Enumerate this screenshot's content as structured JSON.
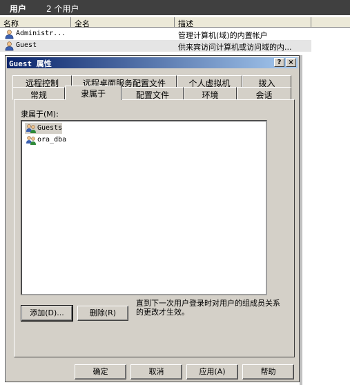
{
  "header": {
    "title": "用户",
    "count": "2 个用户"
  },
  "columns": {
    "name": "名称",
    "fullname": "全名",
    "description": "描述"
  },
  "users": [
    {
      "name": "Administr...",
      "description": "管理计算机(域)的内置帐户"
    },
    {
      "name": "Guest",
      "description": "供来宾访问计算机或访问域的内..."
    }
  ],
  "dialog": {
    "title": "Guest 属性",
    "help_glyph": "?",
    "close_glyph": "×",
    "tabs_back": [
      "远程控制",
      "远程桌面服务配置文件",
      "个人虚拟机",
      "拨入"
    ],
    "tabs_front": [
      "常规",
      "隶属于",
      "配置文件",
      "环境",
      "会话"
    ],
    "active_tab": "隶属于",
    "member_of_label": "隶属于(M):",
    "groups": [
      "Guests",
      "ora_dba"
    ],
    "selected_group": "Guests",
    "add_button": "添加(D)...",
    "remove_button": "删除(R)",
    "note": "直到下一次用户登录时对用户的组成员关系的更改才生效。",
    "ok": "确定",
    "cancel": "取消",
    "apply": "应用(A)",
    "help": "帮助"
  }
}
